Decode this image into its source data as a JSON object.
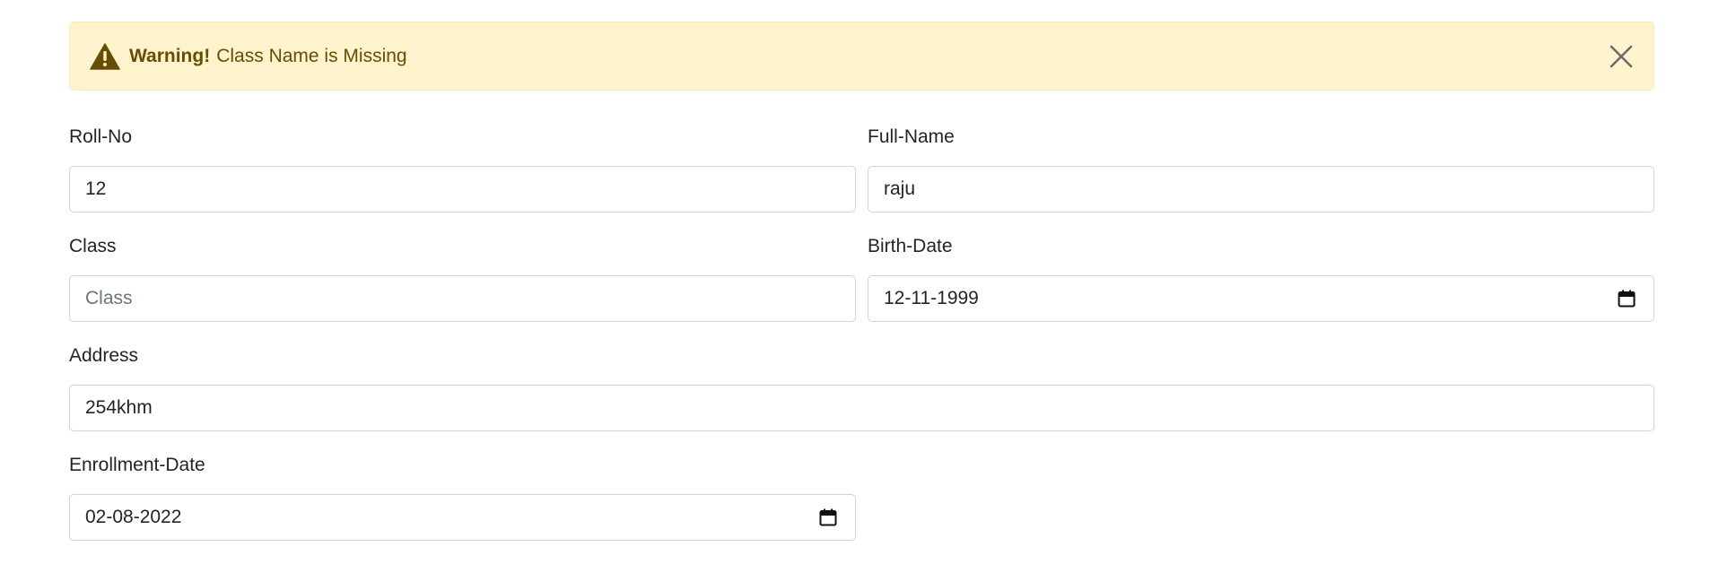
{
  "alert": {
    "strong": "Warning!",
    "message": "Class Name is Missing",
    "icon": "warning-triangle-icon",
    "close_icon": "close-icon"
  },
  "form": {
    "roll_no": {
      "label": "Roll-No",
      "value": "12"
    },
    "full_name": {
      "label": "Full-Name",
      "value": "raju"
    },
    "class": {
      "label": "Class",
      "value": "",
      "placeholder": "Class"
    },
    "birth_date": {
      "label": "Birth-Date",
      "value": "12-11-1999",
      "icon": "calendar-icon"
    },
    "address": {
      "label": "Address",
      "value": "254khm"
    },
    "enrollment_date": {
      "label": "Enrollment-Date",
      "value": "02-08-2022",
      "icon": "calendar-icon"
    }
  },
  "colors": {
    "alert_bg": "#fff3cd",
    "alert_border": "#ffecb5",
    "alert_text": "#664d03",
    "input_border": "#ced4da",
    "placeholder": "#6c757d"
  }
}
